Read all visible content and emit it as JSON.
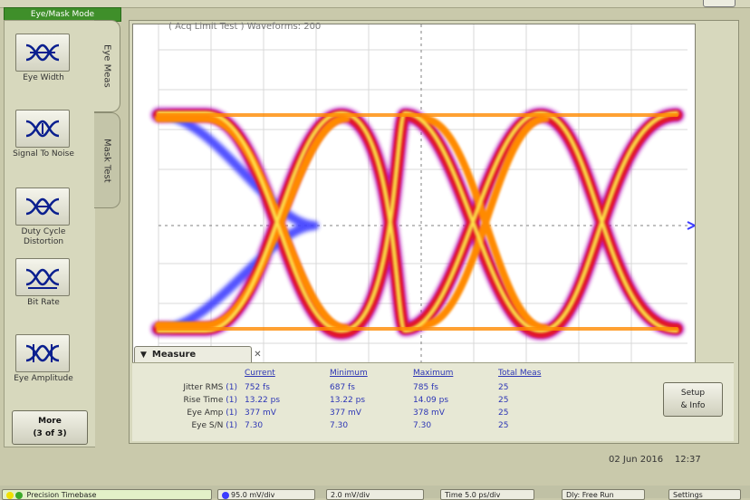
{
  "header": {
    "mode_tab": "Eye/Mask Mode"
  },
  "left_panel": {
    "buttons": [
      {
        "label": "Eye Width"
      },
      {
        "label": "Signal To Noise"
      },
      {
        "label": "Duty Cycle Distortion"
      },
      {
        "label": "Bit Rate"
      },
      {
        "label": "Eye Amplitude"
      }
    ],
    "more": {
      "line1": "More",
      "line2": "(3 of 3)"
    }
  },
  "tabs": {
    "eye_meas": "Eye Meas",
    "mask_test": "Mask Test"
  },
  "plot": {
    "acq_label": "( Acq Limit Test )  Waveforms: 200"
  },
  "measure": {
    "tab_title": "Measure",
    "close_glyph": "✕",
    "columns": [
      "Current",
      "Minimum",
      "Maximum",
      "Total Meas"
    ],
    "rows": [
      {
        "label": "Jitter RMS",
        "values": [
          "752 fs",
          "687 fs",
          "785 fs",
          "25"
        ]
      },
      {
        "label": "Rise Time",
        "values": [
          "13.22 ps",
          "13.22 ps",
          "14.09 ps",
          "25"
        ]
      },
      {
        "label": "Eye Amp",
        "values": [
          "377 mV",
          "377 mV",
          "378 mV",
          "25"
        ]
      },
      {
        "label": "Eye S/N",
        "values": [
          "7.30",
          "7.30",
          "7.30",
          "25"
        ]
      }
    ],
    "channel_marker": "(1)",
    "setup_line1": "Setup",
    "setup_line2": "& Info"
  },
  "timestamp": {
    "date": "02 Jun 2016",
    "time": "12:37"
  },
  "status_bar": {
    "timebase": "Precision Timebase",
    "ch1": "95.0 mV/div",
    "ch2": "2.0 mV/div",
    "time": "Time 5.0 ps/div",
    "delay": "Dly: Free Run",
    "settings": "Settings"
  },
  "colors": {
    "panel": "#d7d8bd",
    "accent_green": "#3f8f2a",
    "text_blue": "#2c35b5",
    "trace_yellow": "#ffe34a",
    "trace_orange": "#ff8a00",
    "trace_red": "#e3142c",
    "trace_magenta": "#b400b4",
    "trace_blue": "#3c3cff"
  }
}
